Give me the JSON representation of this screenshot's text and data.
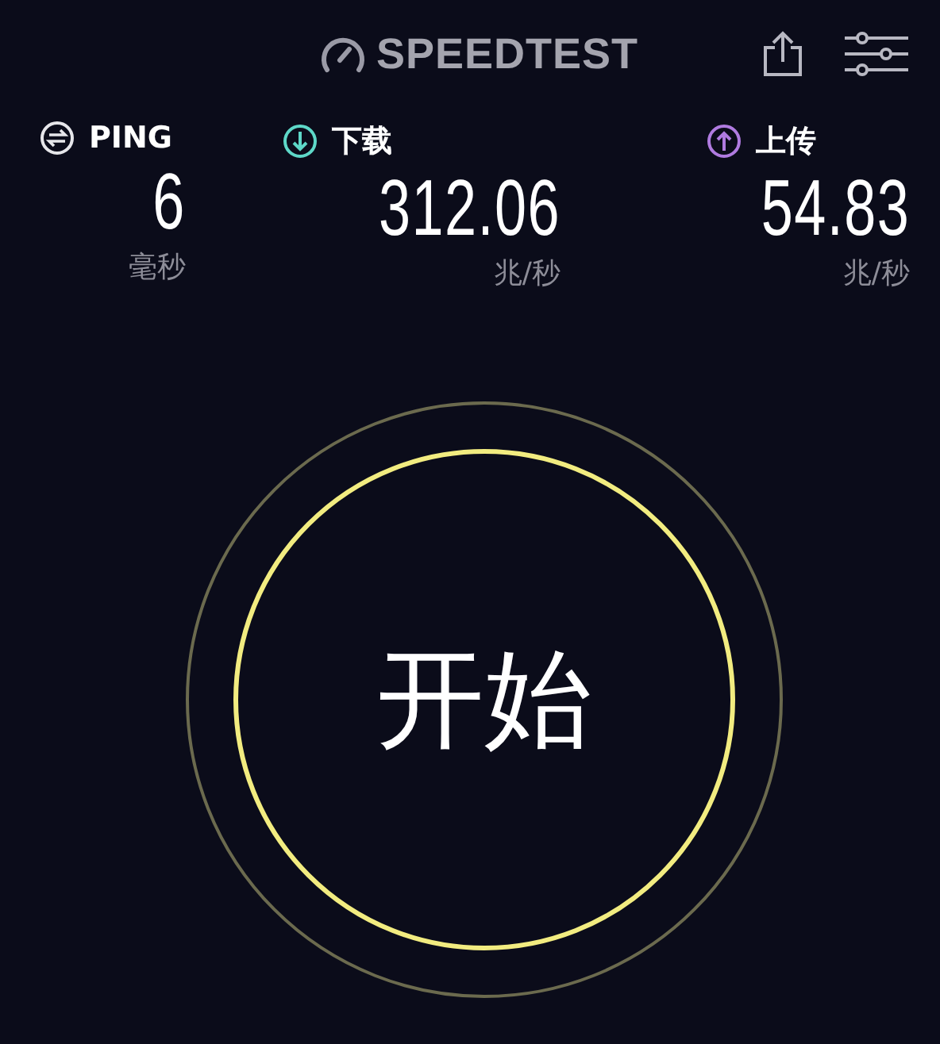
{
  "header": {
    "logo": "SPEEDTEST"
  },
  "metrics": [
    {
      "kind": "ping",
      "label": "PING",
      "value": "6",
      "unit": "毫秒",
      "color": "#e6e6ea"
    },
    {
      "kind": "download",
      "label": "下载",
      "value": "312.06",
      "unit": "兆/秒",
      "color": "#5ed8c8"
    },
    {
      "kind": "upload",
      "label": "上传",
      "value": "54.83",
      "unit": "兆/秒",
      "color": "#b07be0"
    }
  ],
  "start_button": {
    "label": "开始"
  }
}
